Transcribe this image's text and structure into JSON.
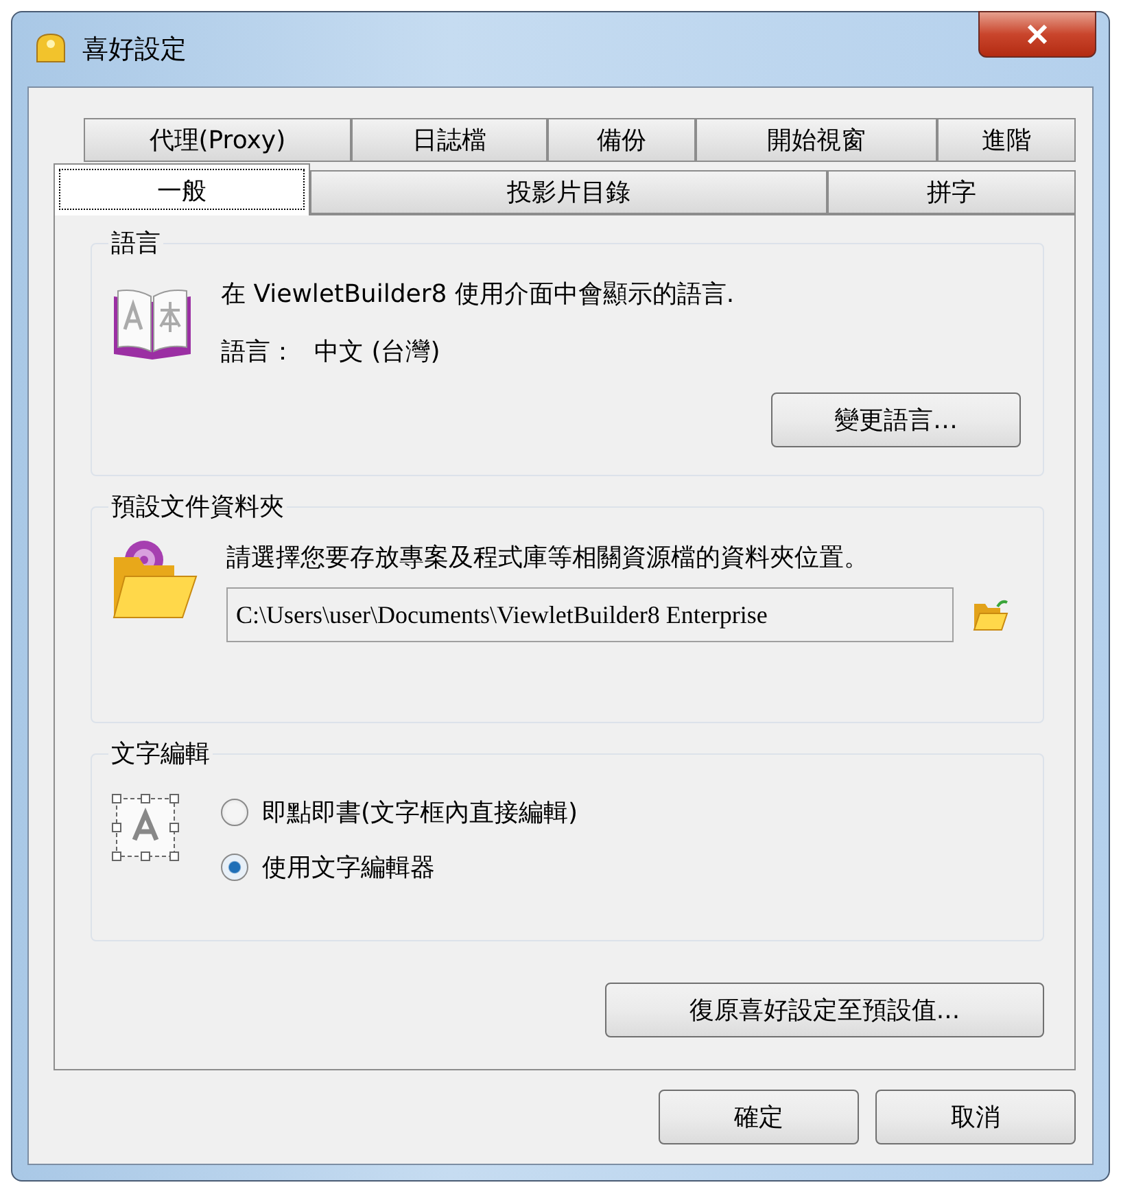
{
  "window": {
    "title": "喜好設定"
  },
  "tab_rows": [
    [
      {
        "label": "代理(Proxy)",
        "selected": false
      },
      {
        "label": "日誌檔",
        "selected": false
      },
      {
        "label": "備份",
        "selected": false
      },
      {
        "label": "開始視窗",
        "selected": false
      },
      {
        "label": "進階",
        "selected": false
      }
    ],
    [
      {
        "label": "一般",
        "selected": true
      },
      {
        "label": "投影片目錄",
        "selected": false
      },
      {
        "label": "拼字",
        "selected": false
      }
    ]
  ],
  "language": {
    "title": "語言",
    "description": "在 ViewletBuilder8 使用介面中會顯示的語言.",
    "label": "語言：",
    "value": "中文 (台灣)",
    "button": "變更語言…"
  },
  "folder": {
    "title": "預設文件資料夾",
    "description": "請選擇您要存放專案及程式庫等相關資源檔的資料夾位置。",
    "path": "C:\\Users\\user\\Documents\\ViewletBuilder8 Enterprise"
  },
  "text_editing": {
    "title": "文字編輯",
    "options": [
      {
        "label": "即點即書(文字框內直接編輯)",
        "selected": false
      },
      {
        "label": "使用文字編輯器",
        "selected": true
      }
    ]
  },
  "restore_button": "復原喜好設定至預設值...",
  "buttons": [
    "確定",
    "取消"
  ]
}
